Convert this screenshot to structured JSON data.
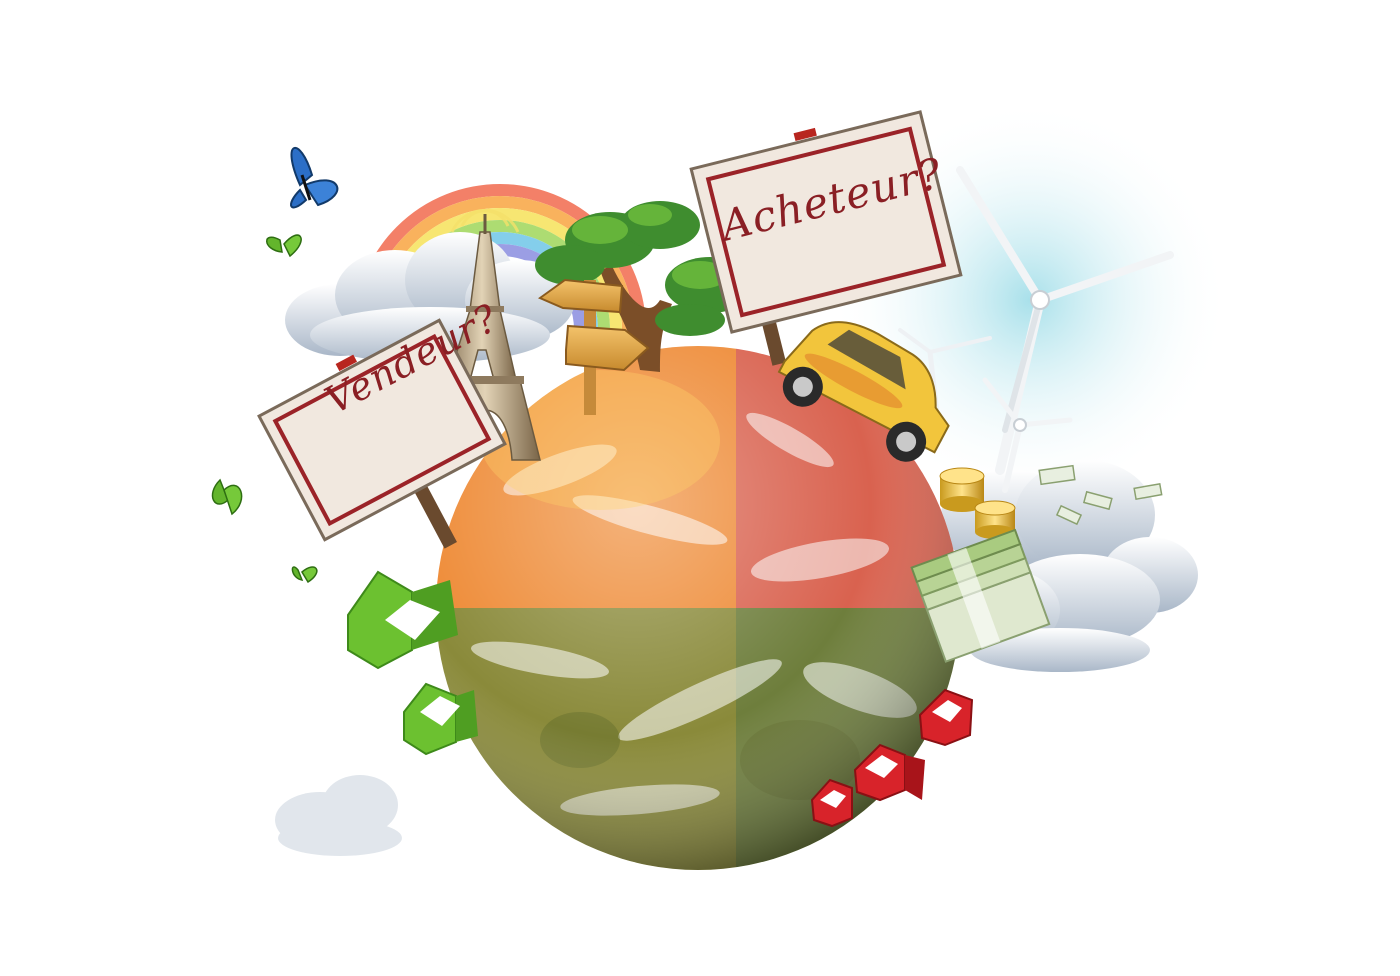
{
  "signs": {
    "seller": "Vendeur?",
    "buyer": "Acheteur?"
  },
  "colors": {
    "sign_text": "#8a1f24",
    "sign_border": "#9b2328",
    "sign_paper": "#f1e8df",
    "globe_orange": "#f08a2a",
    "globe_red": "#d5584a",
    "globe_green": "#7c8a34",
    "house_green": "#6cc130",
    "house_red": "#d8232a",
    "butterfly_blue": "#2c6fc7",
    "butterfly_green": "#63b52c"
  },
  "icons": [
    "globe-icon",
    "rainbow-icon",
    "eiffel-tower-icon",
    "tree-icon",
    "signpost-icon",
    "car-icon",
    "wind-turbine-icon",
    "coins-icon",
    "banknotes-icon",
    "house-icon",
    "butterfly-icon",
    "cloud-icon"
  ]
}
